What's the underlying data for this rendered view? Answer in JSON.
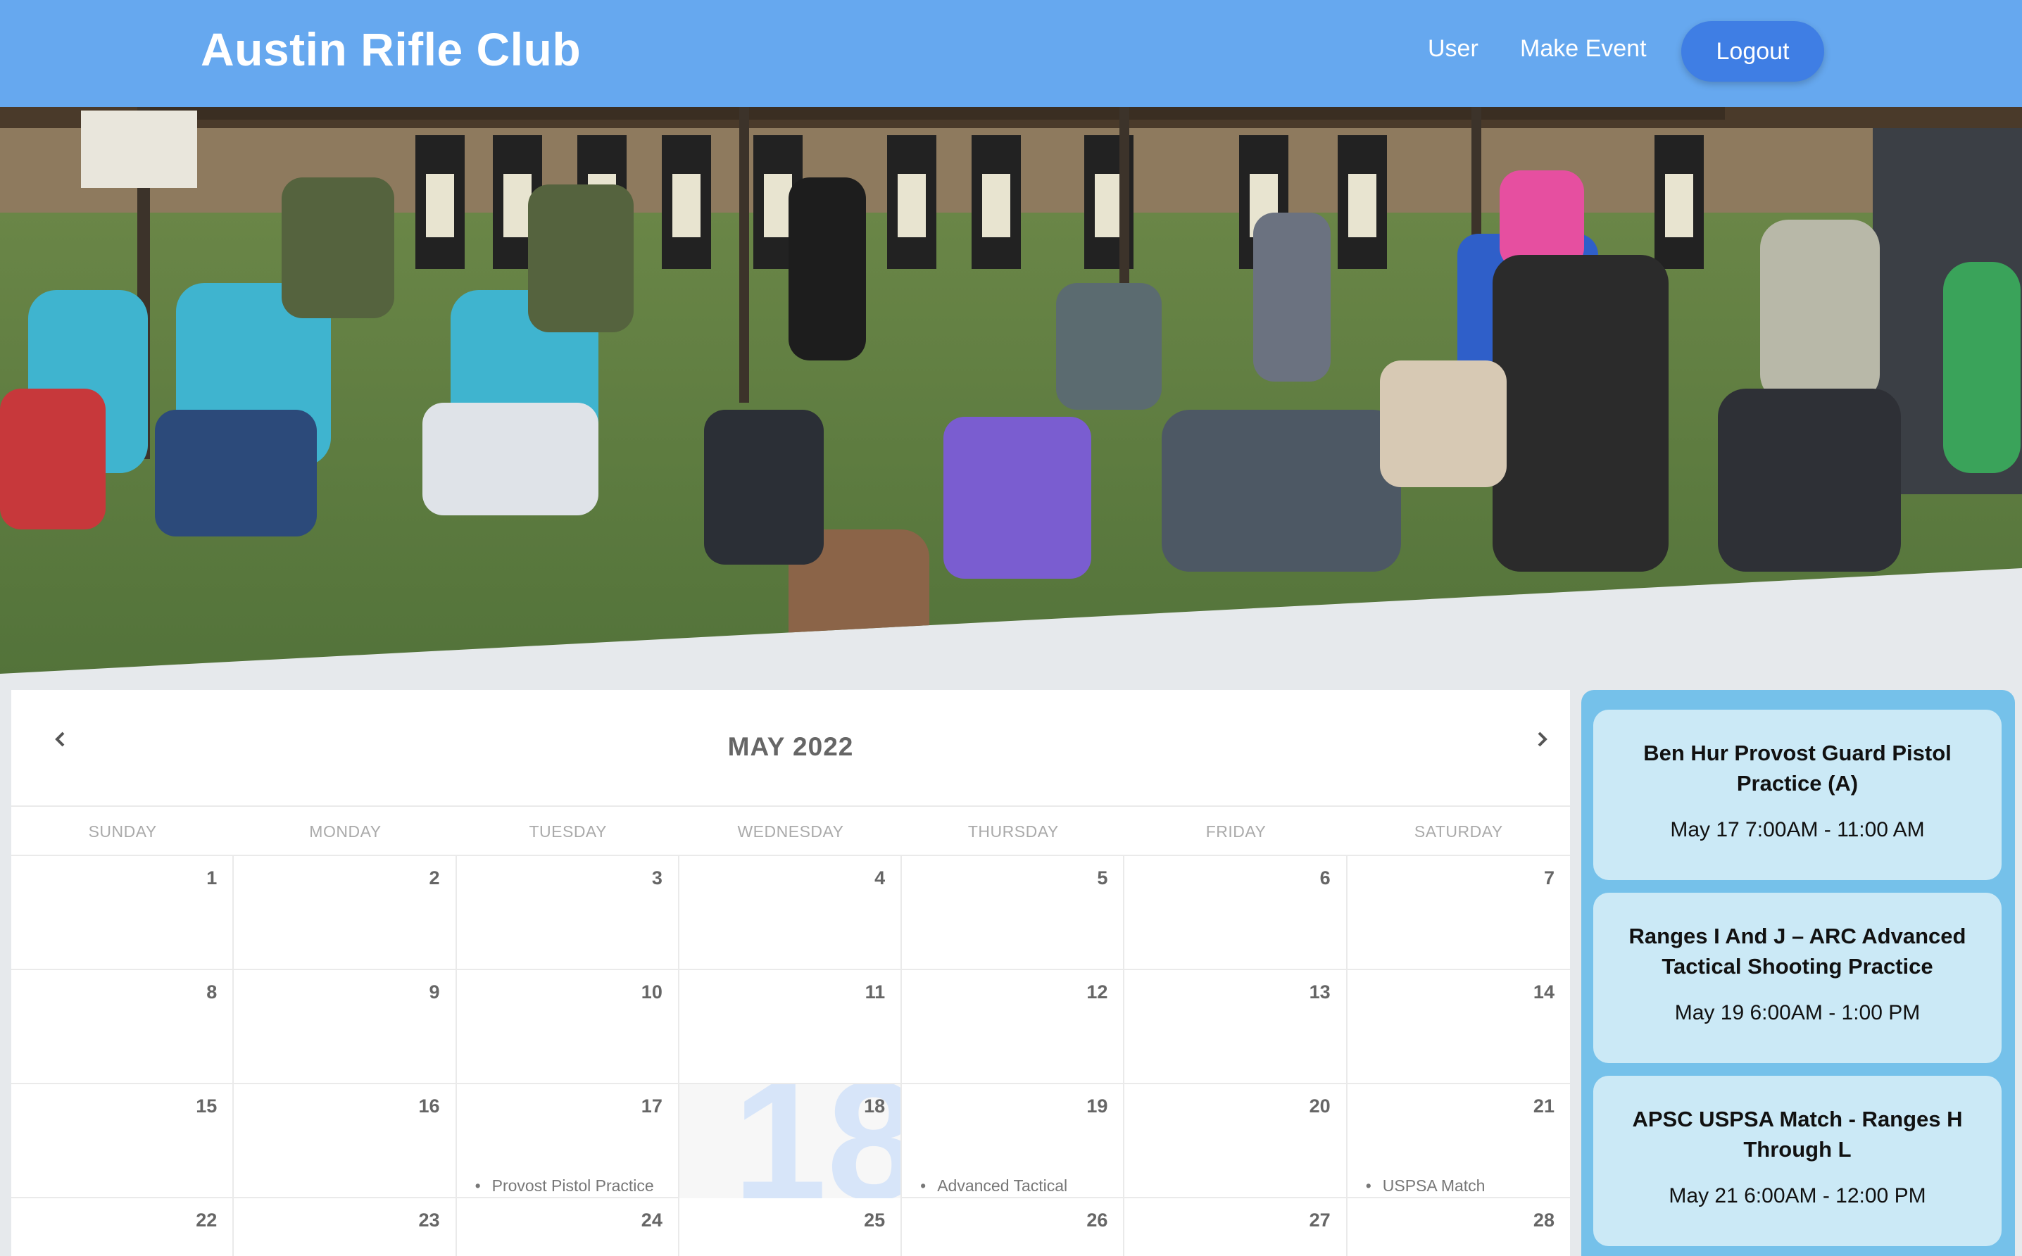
{
  "header": {
    "title": "Austin Rifle Club",
    "nav": {
      "user": "User",
      "make_event": "Make Event",
      "logout": "Logout"
    },
    "color": "#66a8ef",
    "logout_color": "#3f7ee4"
  },
  "calendar": {
    "title": "MAY 2022",
    "prev_icon": "chevron-left-icon",
    "next_icon": "chevron-right-icon",
    "weekdays": [
      "SUNDAY",
      "MONDAY",
      "TUESDAY",
      "WEDNESDAY",
      "THURSDAY",
      "FRIDAY",
      "SATURDAY"
    ],
    "today": "18",
    "weeks": [
      [
        {
          "n": "1"
        },
        {
          "n": "2"
        },
        {
          "n": "3"
        },
        {
          "n": "4"
        },
        {
          "n": "5"
        },
        {
          "n": "6"
        },
        {
          "n": "7"
        }
      ],
      [
        {
          "n": "8"
        },
        {
          "n": "9"
        },
        {
          "n": "10"
        },
        {
          "n": "11"
        },
        {
          "n": "12"
        },
        {
          "n": "13"
        },
        {
          "n": "14"
        }
      ],
      [
        {
          "n": "15"
        },
        {
          "n": "16"
        },
        {
          "n": "17",
          "event": "Provost Pistol Practice"
        },
        {
          "n": "18",
          "today": true
        },
        {
          "n": "19",
          "event": "Advanced Tactical"
        },
        {
          "n": "20"
        },
        {
          "n": "21",
          "event": "USPSA Match"
        }
      ],
      [
        {
          "n": "22"
        },
        {
          "n": "23"
        },
        {
          "n": "24"
        },
        {
          "n": "25"
        },
        {
          "n": "26"
        },
        {
          "n": "27"
        },
        {
          "n": "28"
        }
      ]
    ]
  },
  "events": [
    {
      "title": "Ben Hur Provost Guard Pistol Practice (A)",
      "time": "May 17 7:00AM - 11:00 AM"
    },
    {
      "title": "Ranges I And J – ARC Advanced Tactical Shooting Practice",
      "time": "May 19 6:00AM - 1:00 PM"
    },
    {
      "title": "APSC USPSA Match - Ranges H Through L",
      "time": "May 21 6:00AM - 12:00 PM"
    }
  ]
}
